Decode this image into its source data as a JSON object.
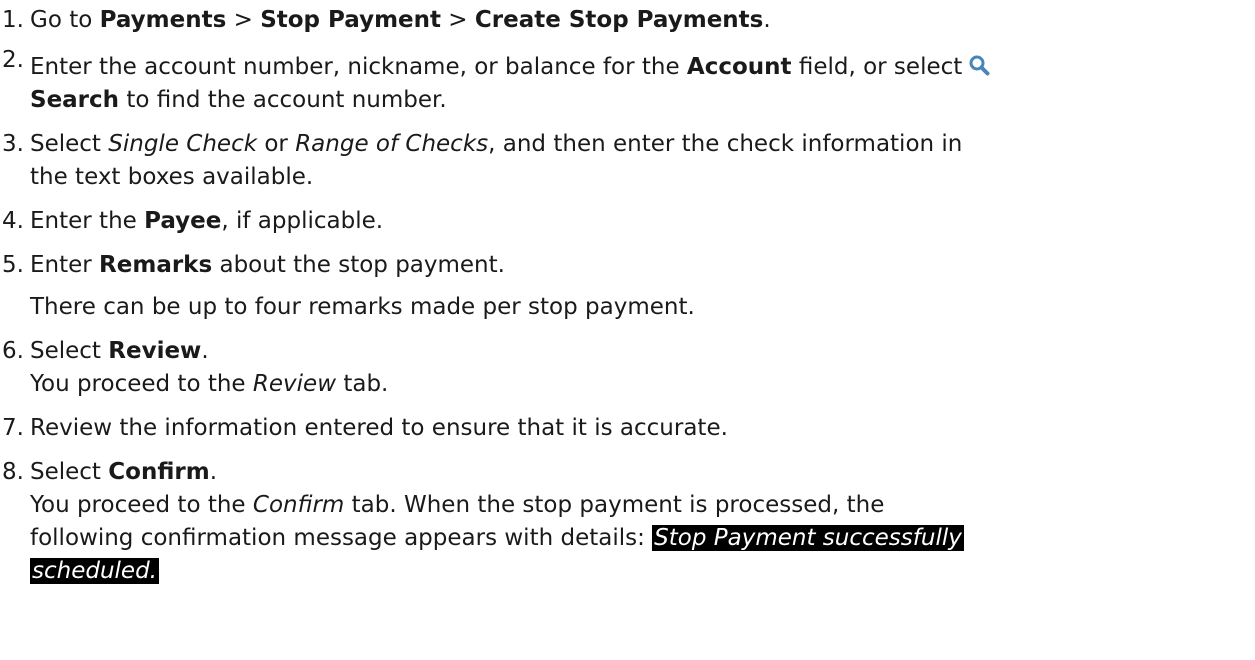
{
  "steps": [
    {
      "number": "1.",
      "pre": "Go to ",
      "b1": "Payments",
      "sep1": " > ",
      "b2": "Stop Payment",
      "sep2": " > ",
      "b3": "Create Stop Payments",
      "post": "."
    },
    {
      "number": "2.",
      "pre": "Enter the account number, nickname, or balance for the ",
      "b1": "Account",
      "mid": " field, or select",
      "icon": "search-icon",
      "b2": "Search",
      "post": " to find the account number."
    },
    {
      "number": "3.",
      "pre": "Select ",
      "i1": "Single Check",
      "mid": " or ",
      "i2": "Range of Checks",
      "post": ", and then enter the check information in",
      "line2": "the text boxes available."
    },
    {
      "number": "4.",
      "pre": "Enter the ",
      "b1": "Payee",
      "post": ", if applicable."
    },
    {
      "number": "5.",
      "pre": "Enter ",
      "b1": "Remarks",
      "post": " about the stop payment.",
      "note": "There can be up to four remarks made per stop payment."
    },
    {
      "number": "6.",
      "pre": "Select ",
      "b1": "Review",
      "post": ".",
      "note_pre": "You proceed to the ",
      "note_i": "Review",
      "note_post": " tab."
    },
    {
      "number": "7.",
      "text": "Review the information entered to ensure that it is accurate."
    },
    {
      "number": "8.",
      "pre": "Select ",
      "b1": "Confirm",
      "post": ".",
      "note_pre": "You proceed to the ",
      "note_i": "Confirm",
      "note_post": " tab. When the stop payment is processed, the",
      "note_line2": "following confirmation message appears with details: ",
      "message_part1": "Stop Payment successfully",
      "message_part2": "scheduled."
    }
  ],
  "colors": {
    "text": "#1a1a1a",
    "highlight_bg": "#000000",
    "highlight_text": "#ffffff",
    "icon": "#4a86b8"
  }
}
